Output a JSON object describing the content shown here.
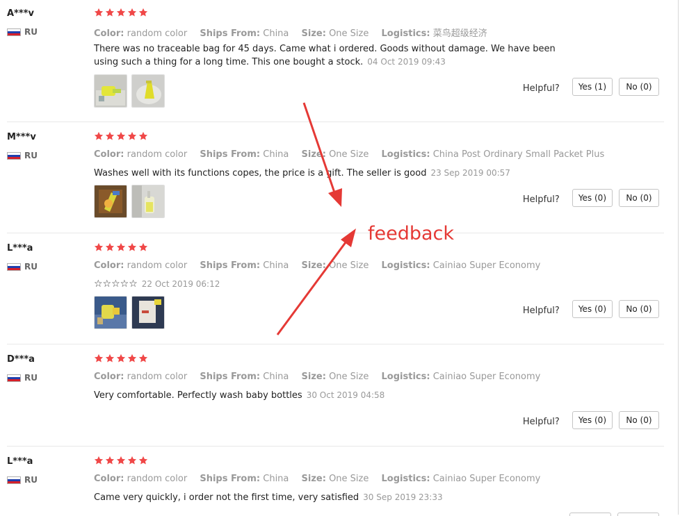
{
  "labels": {
    "color": "Color:",
    "ships_from": "Ships From:",
    "size": "Size:",
    "logistics": "Logistics:",
    "helpful": "Helpful?"
  },
  "colors": {
    "star": "#f04848",
    "annotation": "#e53935"
  },
  "annotation_text": "feedback",
  "reviews": [
    {
      "name": "A***v",
      "country": "RU",
      "rating": 5,
      "color": "random color",
      "ships_from": "China",
      "size": "One Size",
      "logistics": "菜鸟超级经济",
      "text": "There was no traceable bag for 45 days. Came what i ordered. Goods without damage. We have been using such a thing for a long time. This one bought a stock.",
      "date": "04 Oct 2019 09:43",
      "yes": "Yes (1)",
      "no": "No (0)",
      "photos": [
        "photo-1",
        "photo-2"
      ]
    },
    {
      "name": "M***v",
      "country": "RU",
      "rating": 5,
      "color": "random color",
      "ships_from": "China",
      "size": "One Size",
      "logistics": "China Post Ordinary Small Packet Plus",
      "text": "Washes well with its functions copes, the price is a gift. The seller is good",
      "date": "23 Sep 2019 00:57",
      "yes": "Yes (0)",
      "no": "No (0)",
      "photos": [
        "photo-1",
        "photo-2"
      ]
    },
    {
      "name": "L***a",
      "country": "RU",
      "rating": 5,
      "color": "random color",
      "ships_from": "China",
      "size": "One Size",
      "logistics": "Cainiao Super Economy",
      "text": "☆☆☆☆☆",
      "date": "22 Oct 2019 06:12",
      "yes": "Yes (0)",
      "no": "No (0)",
      "photos": [
        "photo-1",
        "photo-2"
      ]
    },
    {
      "name": "D***a",
      "country": "RU",
      "rating": 5,
      "color": "random color",
      "ships_from": "China",
      "size": "One Size",
      "logistics": "Cainiao Super Economy",
      "text": "Very comfortable. Perfectly wash baby bottles",
      "date": "30 Oct 2019 04:58",
      "yes": "Yes (0)",
      "no": "No (0)"
    },
    {
      "name": "L***a",
      "country": "RU",
      "rating": 5,
      "color": "random color",
      "ships_from": "China",
      "size": "One Size",
      "logistics": "Cainiao Super Economy",
      "text": "Came very quickly, i order not the first time, very satisfied",
      "date": "30 Sep 2019 23:33"
    }
  ]
}
